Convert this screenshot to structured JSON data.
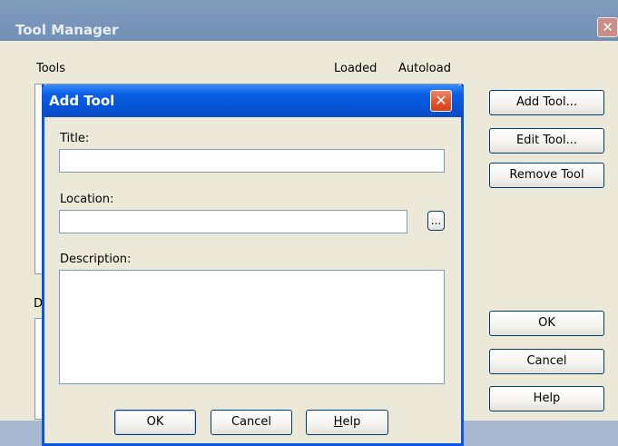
{
  "tool_manager": {
    "title": "Tool Manager",
    "close_glyph": "✕",
    "columns": {
      "tools": "Tools",
      "loaded": "Loaded",
      "autoload": "Autoload"
    },
    "description_label_partial": "D",
    "buttons": {
      "add_tool": "Add Tool...",
      "edit_tool": "Edit Tool...",
      "remove_tool": "Remove Tool",
      "ok": "OK",
      "cancel": "Cancel",
      "help": "Help"
    }
  },
  "add_tool_dialog": {
    "title": "Add Tool",
    "close_glyph": "✕",
    "fields": {
      "title_label": "Title:",
      "title_value": "",
      "location_label": "Location:",
      "location_value": "",
      "browse_label": "...",
      "description_label": "Description:",
      "description_value": ""
    },
    "buttons": {
      "ok": "OK",
      "cancel": "Cancel",
      "help_mnemonic": "H",
      "help_rest": "elp"
    }
  },
  "colors": {
    "dialog_titlebar": "#0453d6",
    "dialog_border": "#0a56e0",
    "close_button": "#e35a2f",
    "inactive_titlebar": "#7b96ba",
    "face": "#ece9d8"
  }
}
